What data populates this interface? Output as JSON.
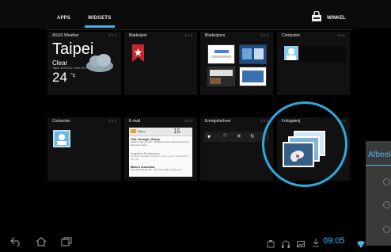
{
  "tabs": {
    "apps": "APPS",
    "widgets": "WIDGETS"
  },
  "shop": {
    "label": "WINKEL",
    "icon": "shop-bag-icon"
  },
  "widgets": {
    "weather": {
      "title": "ASUS Weather",
      "size": "4 x 1",
      "city": "Taipei",
      "condition": "Clear",
      "date": "Taipei 10/5/2012, Wed, 09:05",
      "temp": "24",
      "unit": "°c"
    },
    "bladwijzer": {
      "title": "Bladwijzer",
      "size": "1 x 1"
    },
    "bladwijzers": {
      "title": "Bladwijzers",
      "size": "3 x 3"
    },
    "contacten1": {
      "title": "Contacten",
      "size": "4 x 1"
    },
    "contacten2": {
      "title": "Contacten",
      "size": "1 x 1"
    },
    "email": {
      "title": "E-mail",
      "size": "3 x 3",
      "inbox": "Inbox",
      "count": "15",
      "messages": [
        {
          "from": "Tim, George, Henry",
          "preview": "Good to see you all! · Wanted to drop a line and tell you how nice it was."
        },
        {
          "from": "Angelina Sparkasina",
          "preview": "Come for a game of tennis? I have a court reserved for this Sat."
        },
        {
          "from": "Marco Zucchino",
          "preview": "New Android phone! · We can't wait to show you."
        }
      ]
    },
    "energie": {
      "title": "Energiebeheer",
      "size": "4 x 1"
    },
    "foto": {
      "title": "Fotogalerij",
      "size": "2 x 2"
    }
  },
  "side_panel": {
    "label": "Afbeelding"
  },
  "clock": "09:05",
  "colors": {
    "accent": "#3fb3e6",
    "background": "#000000"
  }
}
